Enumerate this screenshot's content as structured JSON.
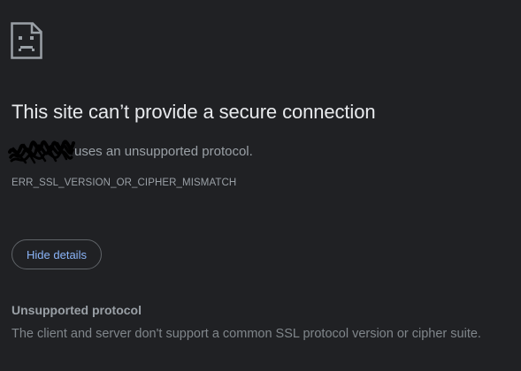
{
  "error_page": {
    "icon": "sad-page-icon",
    "title": "This site can’t provide a secure connection",
    "description_suffix": "uses an unsupported protocol.",
    "error_code": "ERR_SSL_VERSION_OR_CIPHER_MISMATCH",
    "details_button_label": "Hide details"
  },
  "details": {
    "heading": "Unsupported protocol",
    "text": "The client and server don't support a common SSL protocol version or cipher suite."
  },
  "colors": {
    "background": "#202124",
    "title": "#e8eaed",
    "body_text": "#9aa0a6",
    "link_blue": "#8ab4f8",
    "button_border": "#5f6368"
  }
}
